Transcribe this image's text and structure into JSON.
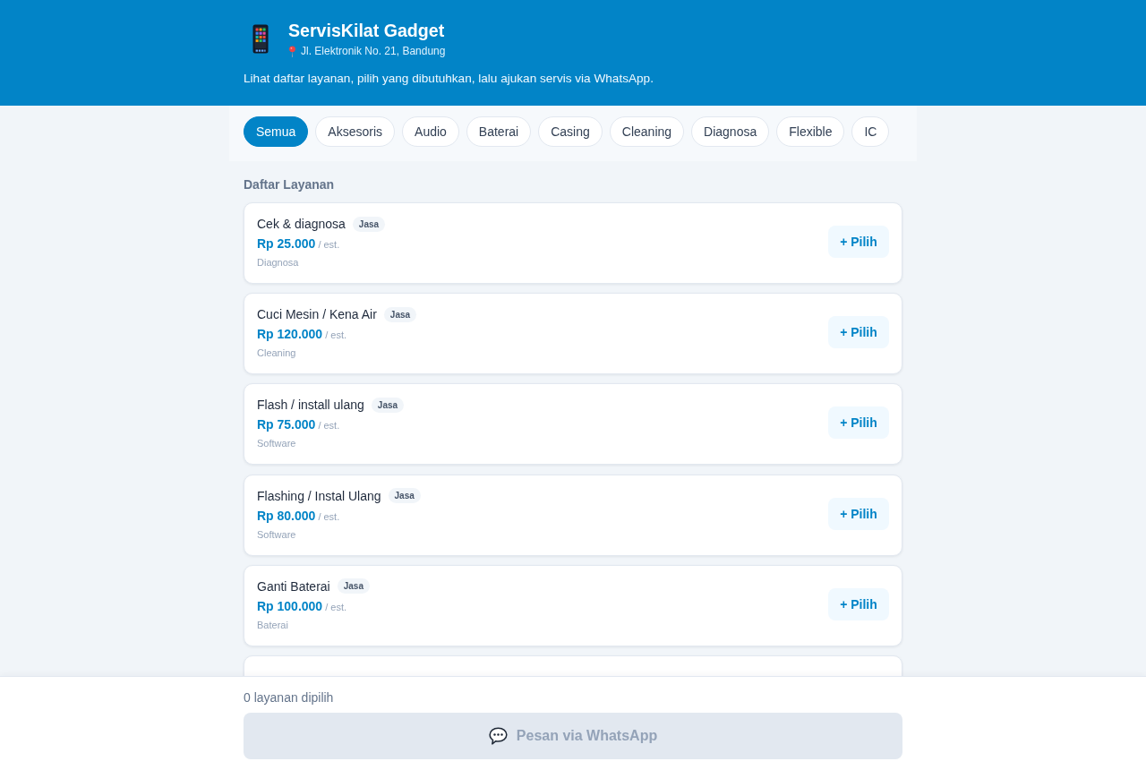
{
  "header": {
    "title": "ServisKilat Gadget",
    "address": "Jl. Elektronik No. 21, Bandung",
    "description": "Lihat daftar layanan, pilih yang dibutuhkan, lalu ajukan servis via WhatsApp."
  },
  "filters": [
    {
      "label": "Semua",
      "selected": true
    },
    {
      "label": "Aksesoris",
      "selected": false
    },
    {
      "label": "Audio",
      "selected": false
    },
    {
      "label": "Baterai",
      "selected": false
    },
    {
      "label": "Casing",
      "selected": false
    },
    {
      "label": "Cleaning",
      "selected": false
    },
    {
      "label": "Diagnosa",
      "selected": false
    },
    {
      "label": "Flexible",
      "selected": false
    },
    {
      "label": "IC",
      "selected": false
    }
  ],
  "section_title": "Daftar Layanan",
  "services": [
    {
      "kind": "service",
      "name": "Cek & diagnosa",
      "badge": "Jasa",
      "price": "Rp 25.000",
      "unit": "/ est.",
      "category": "Diagnosa",
      "action": "+ Pilih"
    },
    {
      "kind": "service",
      "name": "Cuci Mesin / Kena Air",
      "badge": "Jasa",
      "price": "Rp 120.000",
      "unit": "/ est.",
      "category": "Cleaning",
      "action": "+ Pilih"
    },
    {
      "kind": "service",
      "name": "Flash / install ulang",
      "badge": "Jasa",
      "price": "Rp 75.000",
      "unit": "/ est.",
      "category": "Software",
      "action": "+ Pilih"
    },
    {
      "kind": "service",
      "name": "Flashing / Instal Ulang",
      "badge": "Jasa",
      "price": "Rp 80.000",
      "unit": "/ est.",
      "category": "Software",
      "action": "+ Pilih"
    },
    {
      "kind": "service",
      "name": "Ganti Baterai",
      "badge": "Jasa",
      "price": "Rp 100.000",
      "unit": "/ est.",
      "category": "Baterai",
      "action": "+ Pilih"
    },
    {
      "kind": "cut_off"
    }
  ],
  "footer": {
    "count": "0 layanan dipilih",
    "button": {
      "label": "Pesan via WhatsApp",
      "disabled": true
    }
  }
}
